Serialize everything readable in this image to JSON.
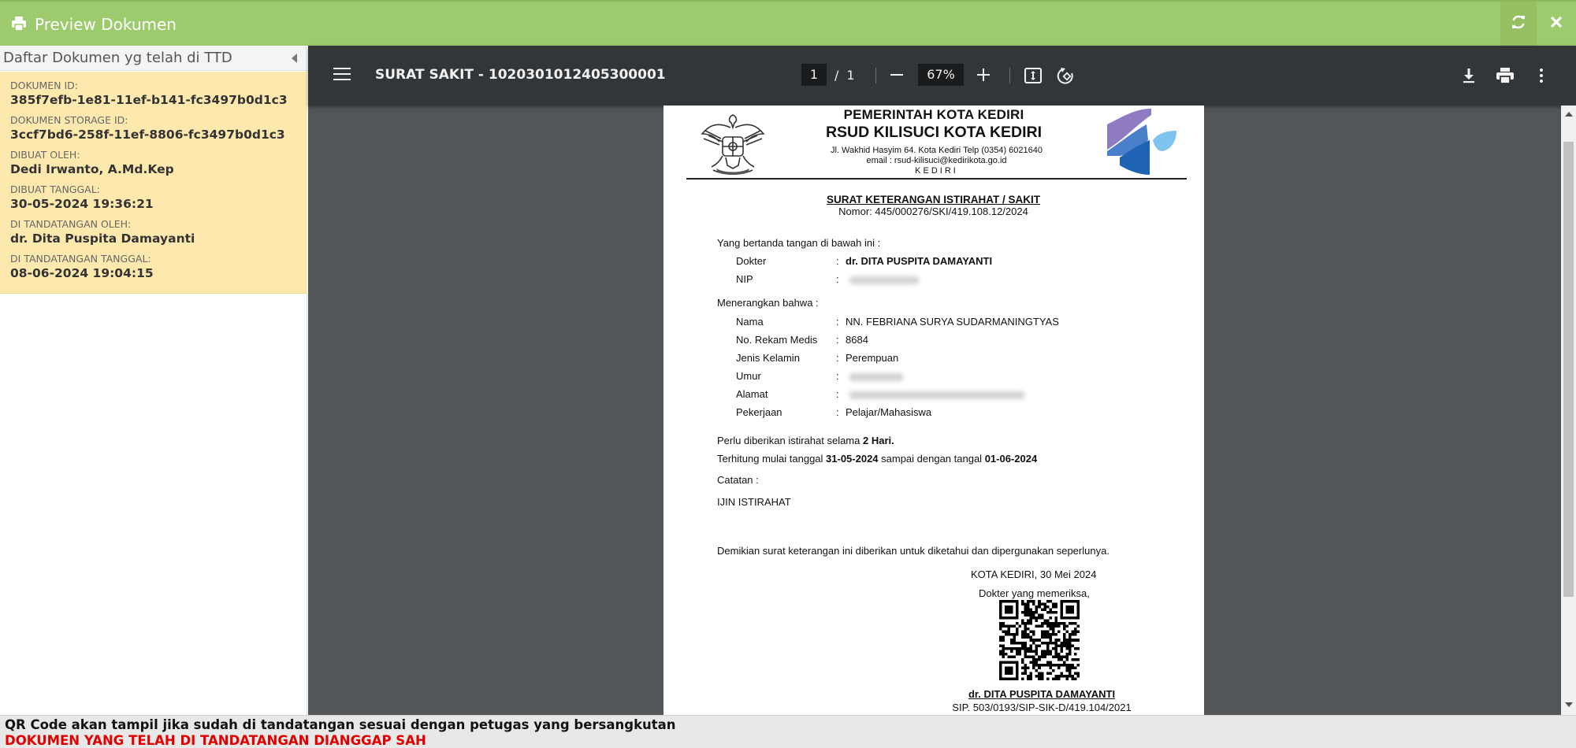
{
  "titlebar": {
    "title": "Preview Dokumen",
    "icon": "print-icon",
    "refresh_icon": "refresh-icon",
    "close_icon": "close-icon",
    "color": "#9dca6d"
  },
  "sidebar": {
    "title": "Daftar Dokumen yg telah di TTD",
    "info": [
      {
        "label": "DOKUMEN ID:",
        "value": "385f7efb-1e81-11ef-b141-fc3497b0d1c3"
      },
      {
        "label": "DOKUMEN STORAGE ID:",
        "value": "3ccf7bd6-258f-11ef-8806-fc3497b0d1c3"
      },
      {
        "label": "DIBUAT OLEH:",
        "value": "Dedi Irwanto, A.Md.Kep"
      },
      {
        "label": "DIBUAT TANGGAL:",
        "value": "30-05-2024 19:36:21"
      },
      {
        "label": "DI TANDATANGAN OLEH:",
        "value": "dr. Dita Puspita Damayanti"
      },
      {
        "label": "DI TANDATANGAN TANGGAL:",
        "value": "08-06-2024 19:04:15"
      }
    ],
    "info_bg": "#fde9ae"
  },
  "viewer": {
    "doc_title": "SURAT SAKIT - 1020301012405300001",
    "page_current": "1",
    "page_sep": "/",
    "page_total": "1",
    "zoom": "67%",
    "icons": [
      "menu-icon",
      "zoom-out-icon",
      "zoom-in-icon",
      "fit-page-icon",
      "rotate-icon",
      "download-icon",
      "print-icon",
      "more-icon"
    ]
  },
  "document": {
    "header1": "PEMERINTAH KOTA KEDIRI",
    "header2": "RSUD KILISUCI KOTA KEDIRI",
    "address": "Jl. Wakhid Hasyim 64. Kota Kediri Telp (0354) 6021640",
    "email": "email : rsud-kilisuci@kedirikota.go.id",
    "city": "KEDIRI",
    "title": "SURAT KETERANGAN ISTIRAHAT / SAKIT",
    "number": "Nomor: 445/000276/SKI/419.108.12/2024",
    "intro": "Yang bertanda tangan di bawah ini :",
    "doctor_label": "Dokter",
    "doctor_value": "dr. DITA PUSPITA DAMAYANTI",
    "nip_label": "NIP",
    "explains": "Menerangkan bahwa :",
    "nama_label": "Nama",
    "nama_value": "NN. FEBRIANA SURYA SUDARMANINGTYAS",
    "rm_label": "No.  Rekam Medis",
    "rm_value": "8684",
    "jk_label": "Jenis Kelamin",
    "jk_value": "Perempuan",
    "umur_label": "Umur",
    "alamat_label": "Alamat",
    "pekerjaan_label": "Pekerjaan",
    "pekerjaan_value": "Pelajar/Mahasiswa",
    "colon": ":",
    "rest_text": "Perlu diberikan istirahat selama ",
    "rest_days": "2 Hari.",
    "from_text": "Terhitung mulai tanggal ",
    "from_date": "31-05-2024",
    "until_text": " sampai dengan tangal ",
    "until_date": "01-06-2024",
    "note_label": "Catatan :",
    "note_value": "IJIN ISTIRAHAT",
    "closing": "Demikian surat keterangan ini diberikan untuk diketahui dan dipergunakan seperlunya.",
    "place_date": "KOTA KEDIRI, 30 Mei 2024",
    "examiner": "Dokter yang memeriksa,",
    "signer": "dr. DITA PUSPITA DAMAYANTI",
    "sip": "SIP. 503/0193/SIP-SIK-D/419.104/2021"
  },
  "footer": {
    "line1": "QR Code akan tampil jika sudah di tandatangan sesuai dengan petugas yang bersangkutan",
    "line2": "DOKUMEN YANG TELAH DI TANDATANGAN DIANGGAP SAH",
    "line2_color": "#e00000"
  }
}
